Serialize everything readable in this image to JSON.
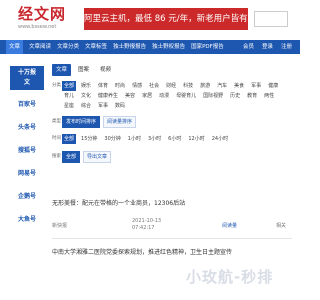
{
  "header": {
    "logo_text": "经文网",
    "logo_sub": "www.bssew.net",
    "ad_text": "阿里云主机，最低 86 元/年，新老用户皆有优惠！",
    "search_placeholder": ""
  },
  "nav": {
    "left": [
      "文章",
      "文章阅读",
      "文章分类",
      "文章标签",
      "独士野报报告",
      "独士野权报告",
      "国家PDF报告"
    ],
    "right": [
      "会员",
      "登录",
      "注册"
    ],
    "active_index": 0
  },
  "sidebar": {
    "items": [
      {
        "label": "十万报\n文",
        "active": true
      },
      {
        "label": "百家号",
        "active": false
      },
      {
        "label": "头条号",
        "active": false
      },
      {
        "label": "搜狐号",
        "active": false
      },
      {
        "label": "网易号",
        "active": false
      },
      {
        "label": "企鹅号",
        "active": false
      },
      {
        "label": "大鱼号",
        "active": false
      }
    ]
  },
  "panel": {
    "tabs": [
      "文章",
      "图案",
      "视频"
    ],
    "active_tab": 0,
    "filters": [
      {
        "label": "分类",
        "options": [
          "全部",
          "娱乐",
          "体育",
          "时尚",
          "情感",
          "社会",
          "财经",
          "科技",
          "旅游",
          "汽车",
          "美食",
          "军事",
          "健康",
          "育儿",
          "文化",
          "健康养生",
          "美容",
          "家居",
          "动漫",
          "母婴育儿",
          "国际视野",
          "历史",
          "教育",
          "两性",
          "星座",
          "综合",
          "军事",
          "数码"
        ],
        "active": 0
      },
      {
        "label": "类型",
        "options": [
          "发布时间排序",
          "阅读量排序"
        ],
        "active": 0,
        "style": "chip"
      },
      {
        "label": "时间",
        "options": [
          "全部",
          "15分钟",
          "30分钟",
          "1小时",
          "3小时",
          "6小时",
          "12小时",
          "24小时"
        ],
        "active": 0
      },
      {
        "label": "搜索",
        "options": [
          "全部",
          "导出文章"
        ],
        "active": 0,
        "style": "chip"
      }
    ]
  },
  "articles": [
    {
      "title": "无形美餐：配元在带格的一个业商员，12306后站",
      "publisher": "新快报",
      "time": "2021-10-13\n07:42:17",
      "views": "阅读量",
      "extra": "相关"
    },
    {
      "title": "中南大学湘雅二医院党委探索规划，推进红色精神，卫生日主题宣传",
      "publisher": "",
      "time": "",
      "views": "",
      "extra": ""
    }
  ],
  "watermark": "小玫航-秒排"
}
